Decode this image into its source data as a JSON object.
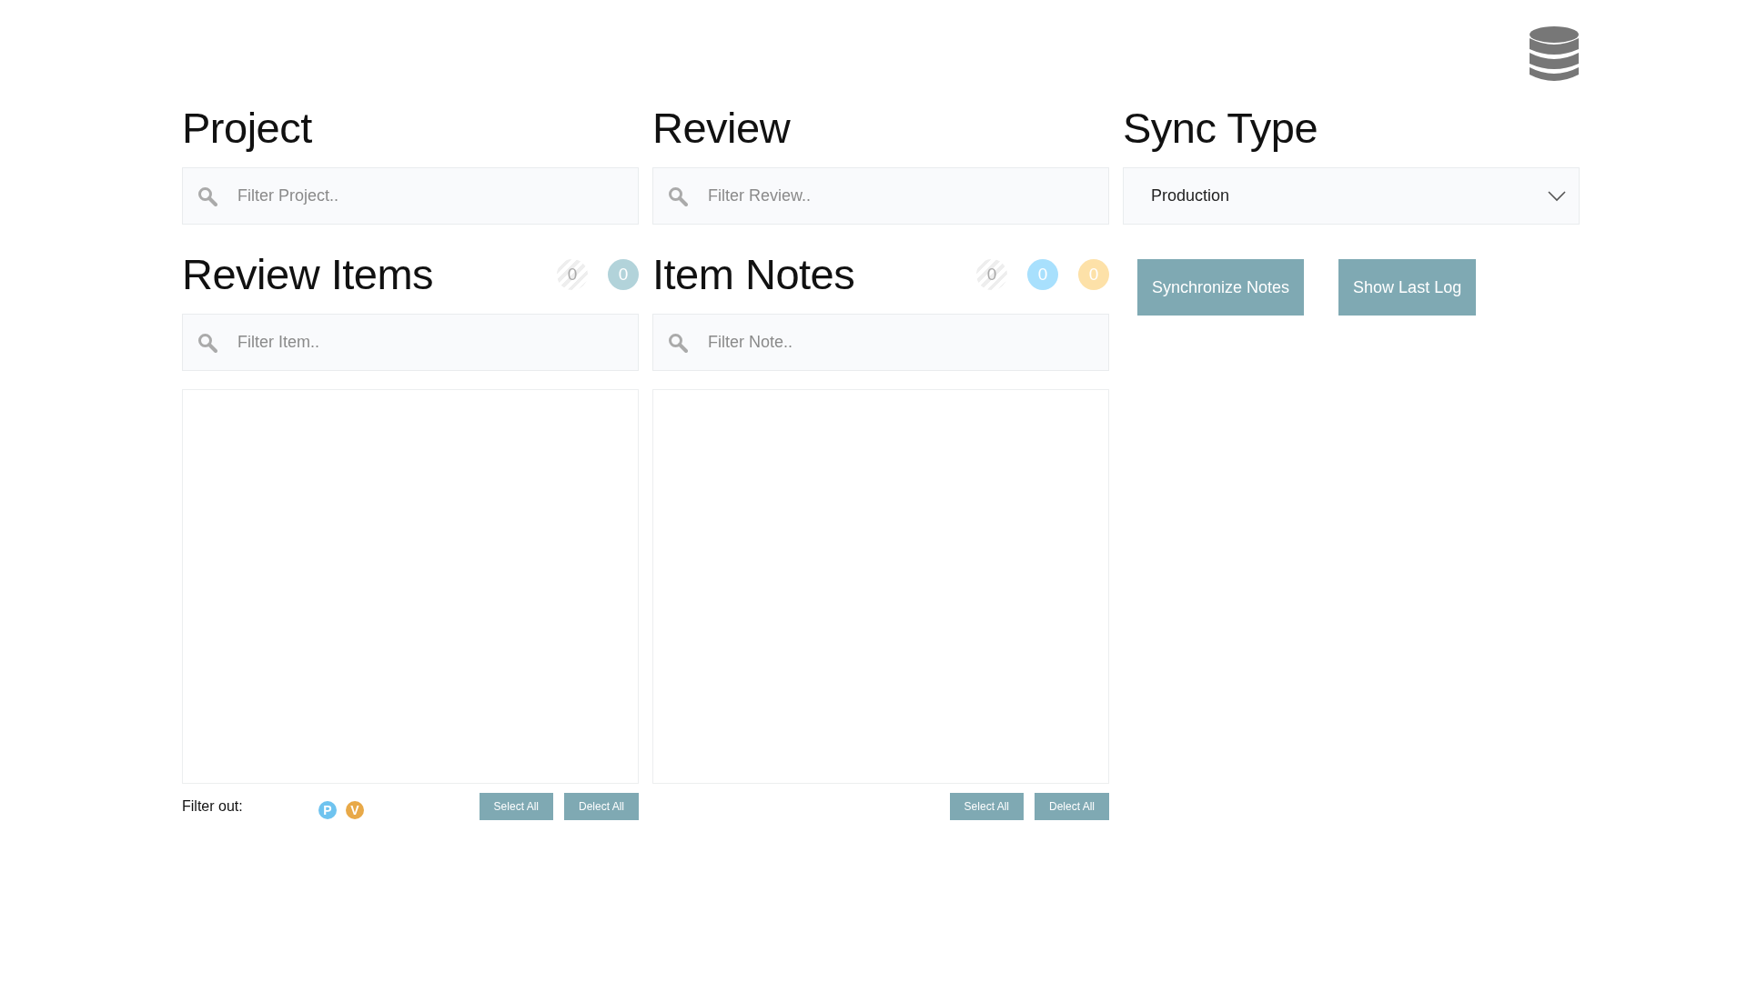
{
  "top_row": [
    {
      "kind": "search",
      "title": "Project",
      "placeholder": "Filter Project.."
    },
    {
      "kind": "search",
      "title": "Review",
      "placeholder": "Filter Review.."
    },
    {
      "kind": "select",
      "title": "Sync Type",
      "value": "Production"
    }
  ],
  "lists": [
    {
      "title": "Review Items",
      "counters": [
        {
          "kind": "striped",
          "value": "0"
        },
        {
          "kind": "solid",
          "value": "0",
          "color": "#b2d3da"
        }
      ],
      "placeholder": "Filter Item..",
      "filter_out": {
        "label": "Filter out:",
        "chips": [
          {
            "text": "P",
            "color": "#6fc3ef"
          },
          {
            "text": "V",
            "color": "#e8a948"
          }
        ]
      },
      "buttons": [
        "Select All",
        "Delect All"
      ]
    },
    {
      "title": "Item Notes",
      "counters": [
        {
          "kind": "striped",
          "value": "0"
        },
        {
          "kind": "solid",
          "value": "0",
          "color": "#a8e0fd"
        },
        {
          "kind": "solid",
          "value": "0",
          "color": "#fde1a8"
        }
      ],
      "placeholder": "Filter Note..",
      "buttons": [
        "Select All",
        "Delect All"
      ]
    }
  ],
  "actions": [
    "Synchronize Notes",
    "Show Last Log"
  ]
}
